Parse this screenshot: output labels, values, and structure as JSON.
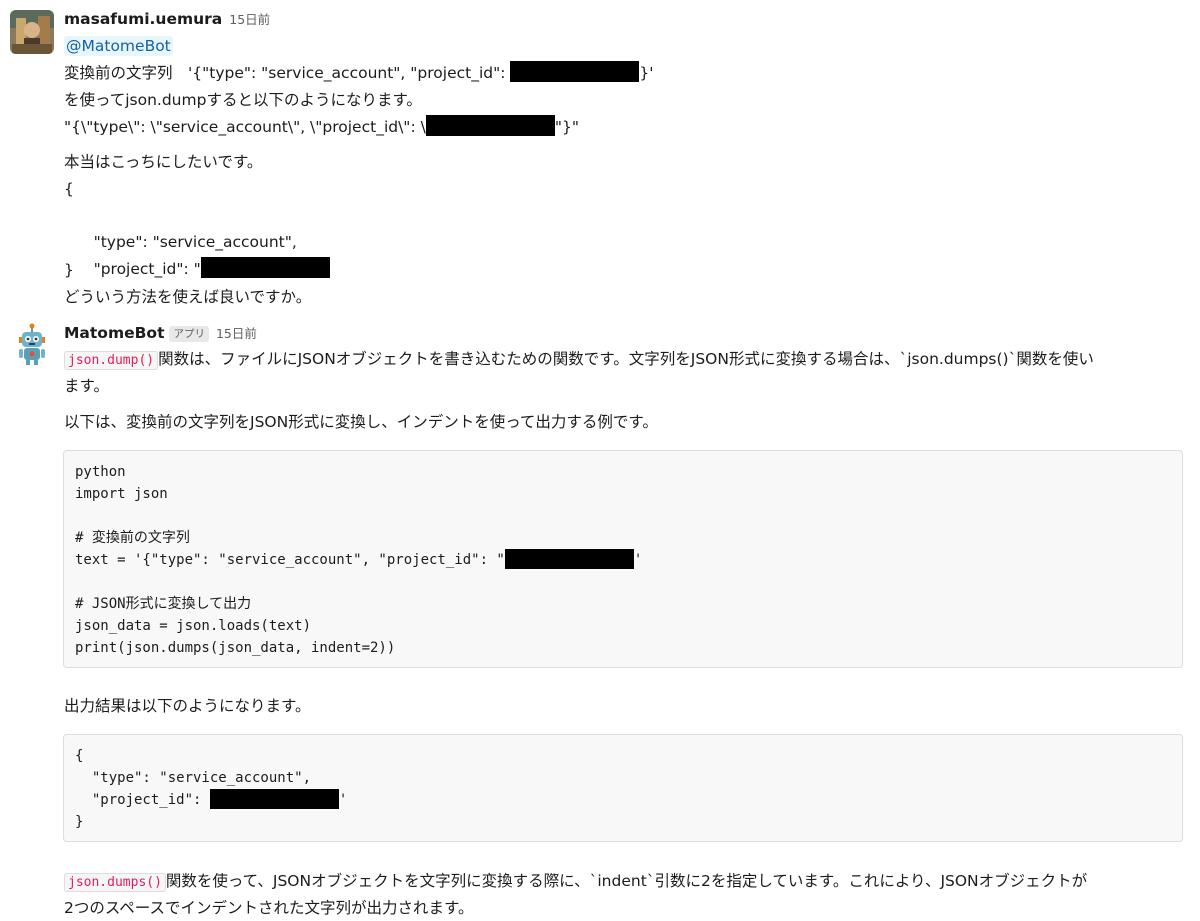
{
  "messages": [
    {
      "user": "masafumi.uemura",
      "timestamp": "15日前",
      "mention": "@MatomeBot",
      "lines": {
        "l1_prefix": "変換前の文字列　'{\"type\": \"service_account\", \"project_id\": ",
        "l1_suffix": "}'",
        "l2": "を使ってjson.dumpすると以下のようになります。",
        "l3_prefix": "\"{\\\"type\\\": \\\"service_account\\\", \\\"project_id\\\": \\",
        "l3_suffix": "\"}\"",
        "l4": "本当はこっちにしたいです。",
        "l5": "{",
        "l6": "  \"type\": \"service_account\",",
        "l7_prefix": "  \"project_id\": \"",
        "l8": "}",
        "l9": "どういう方法を使えば良いですか。"
      },
      "avatar_icon": "user-photo-avatar"
    },
    {
      "user": "MatomeBot",
      "badge": "アプリ",
      "timestamp": "15日前",
      "avatar_icon": "robot-avatar",
      "p1_code": "json.dump()",
      "p1_text": "関数は、ファイルにJSONオブジェクトを書き込むための関数です。文字列をJSON形式に変換する場合は、`json.dumps()`関数を使い",
      "p1_text_2": "ます。",
      "p2": "以下は、変換前の文字列をJSON形式に変換し、インデントを使って出力する例です。",
      "code1": {
        "l1": "python",
        "l2": "import json",
        "l3": "",
        "l4": "# 変換前の文字列",
        "l5_prefix": "text = '{\"type\": \"service_account\", \"project_id\": \"",
        "l5_suffix": "'",
        "l6": "",
        "l7": "# JSON形式に変換して出力",
        "l8": "json_data = json.loads(text)",
        "l9": "print(json.dumps(json_data, indent=2))"
      },
      "p3": "出力結果は以下のようになります。",
      "code2": {
        "l1": "{",
        "l2": "  \"type\": \"service_account\",",
        "l3_prefix": "  \"project_id\": ",
        "l3_suffix": "'",
        "l4": "}"
      },
      "p4_code": "json.dumps()",
      "p4_text": "関数を使って、JSONオブジェクトを文字列に変換する際に、`indent`引数に2を指定しています。これにより、JSONオブジェクトが",
      "p4_text_2": "2つのスペースでインデントされた文字列が出力されます。"
    }
  ],
  "colors": {
    "mention_bg": "#e8f5fa",
    "mention_fg": "#1264a3",
    "inline_code_fg": "#e01e5a",
    "redaction": "#000000"
  }
}
